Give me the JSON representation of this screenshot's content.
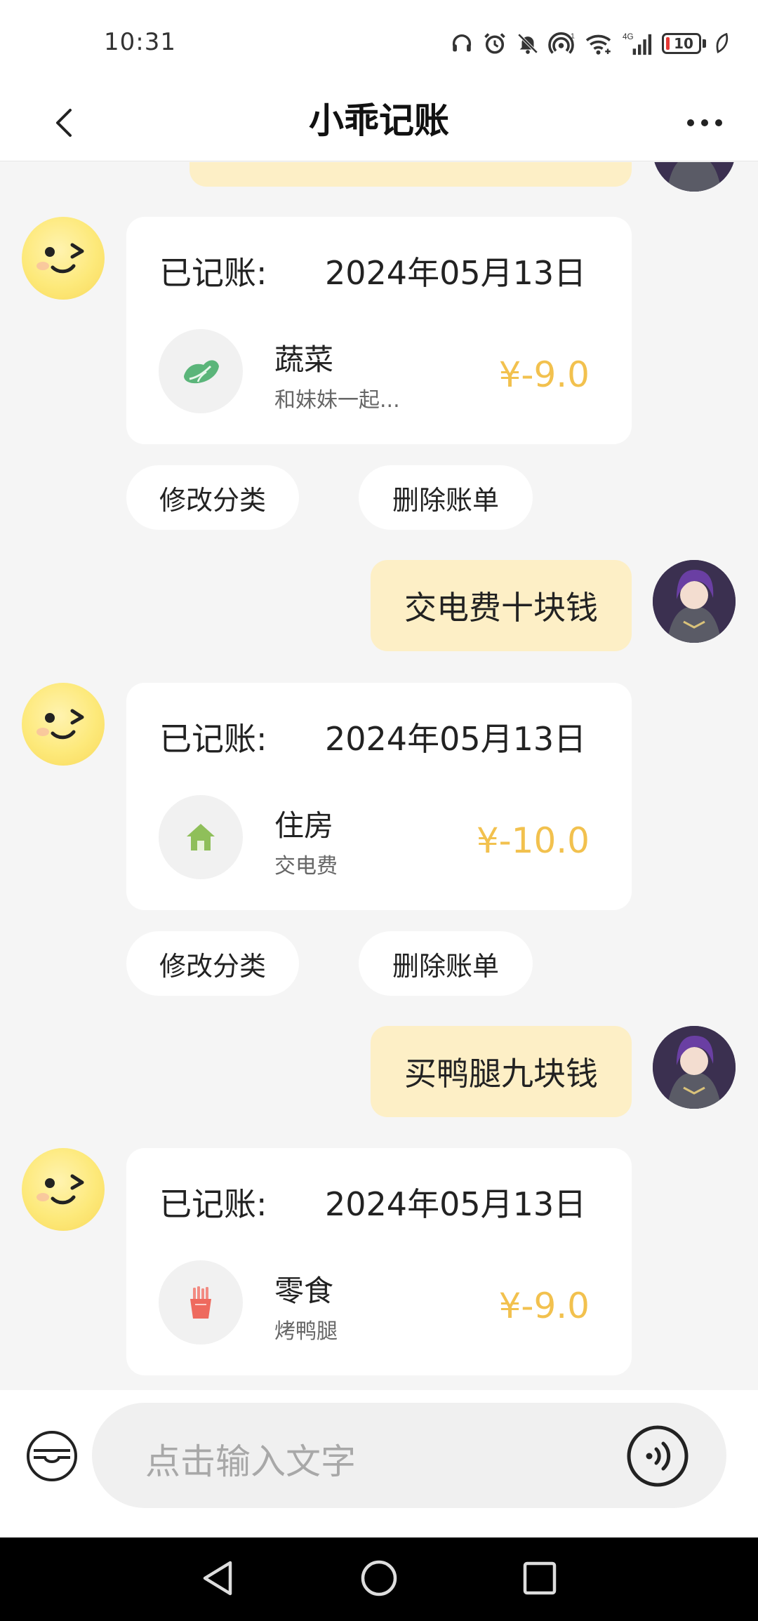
{
  "status_bar": {
    "time": "10:31",
    "battery": "10"
  },
  "header": {
    "title": "小乖记账"
  },
  "messages": [
    {
      "type": "record",
      "recorded_label": "已记账:",
      "date": "2024年05月13日",
      "category": "蔬菜",
      "note": "和妹妹一起...",
      "amount": "¥-9.0",
      "icon": "vegetable-icon",
      "edit_label": "修改分类",
      "delete_label": "删除账单"
    },
    {
      "type": "user",
      "text": "交电费十块钱"
    },
    {
      "type": "record",
      "recorded_label": "已记账:",
      "date": "2024年05月13日",
      "category": "住房",
      "note": "交电费",
      "amount": "¥-10.0",
      "icon": "house-icon",
      "edit_label": "修改分类",
      "delete_label": "删除账单"
    },
    {
      "type": "user",
      "text": "买鸭腿九块钱"
    },
    {
      "type": "record",
      "recorded_label": "已记账:",
      "date": "2024年05月13日",
      "category": "零食",
      "note": "烤鸭腿",
      "amount": "¥-9.0",
      "icon": "fries-icon"
    }
  ],
  "input": {
    "placeholder": "点击输入文字"
  },
  "colors": {
    "amount": "#f2c14e",
    "user_bubble": "#fdefc6",
    "background": "#f5f5f5"
  }
}
